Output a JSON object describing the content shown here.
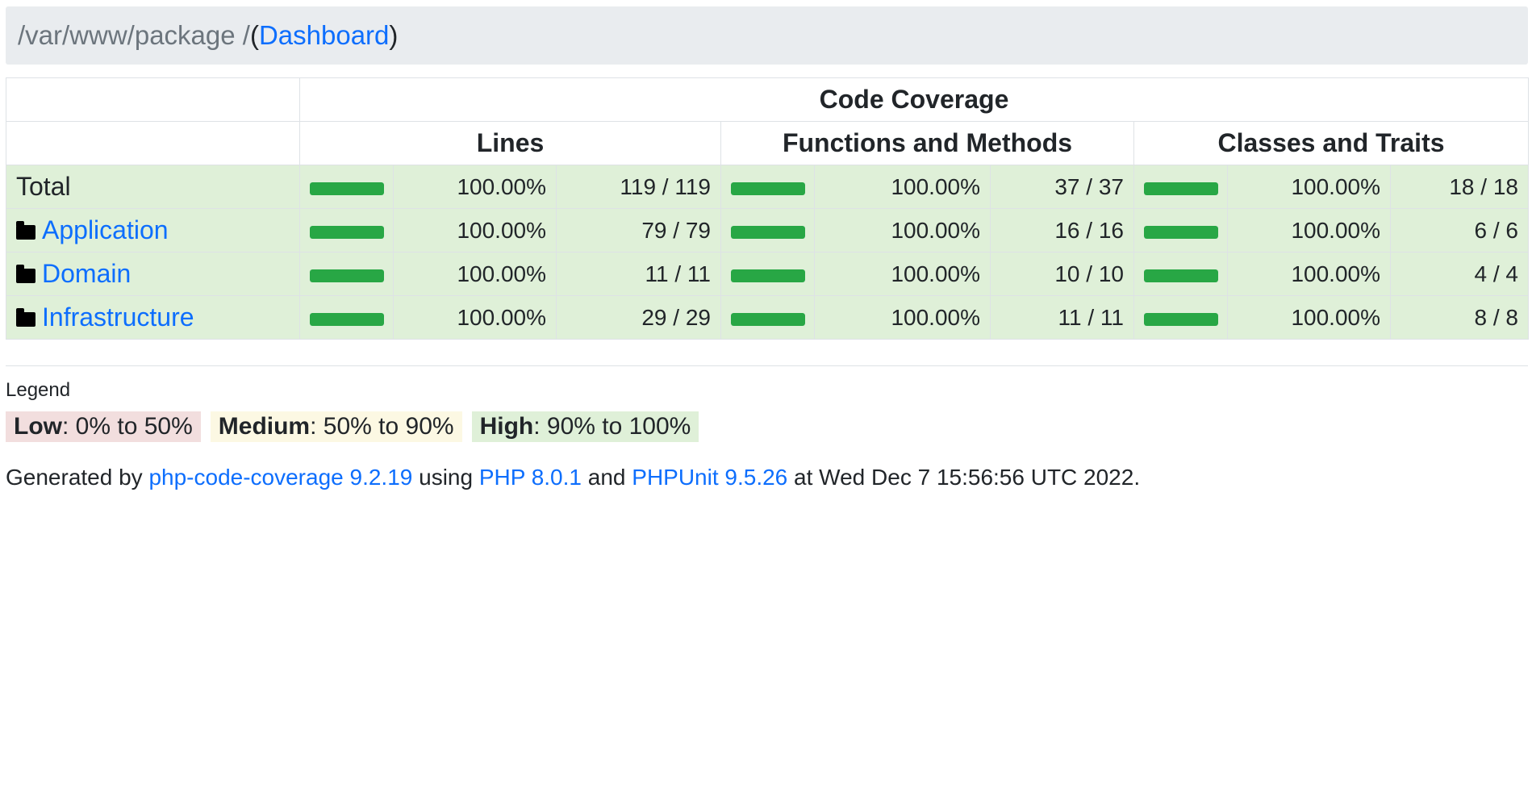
{
  "breadcrumb": {
    "path": "/var/www/package / ",
    "open_paren": "(",
    "dashboard_link": "Dashboard",
    "close_paren": ")"
  },
  "table": {
    "header_group": "Code Coverage",
    "columns": [
      "Lines",
      "Functions and Methods",
      "Classes and Traits"
    ],
    "rows": [
      {
        "name": "Total",
        "is_link": false,
        "lines": {
          "percent": "100.00%",
          "ratio": "119 / 119",
          "fill": 1.0
        },
        "functions": {
          "percent": "100.00%",
          "ratio": "37 / 37",
          "fill": 1.0
        },
        "classes": {
          "percent": "100.00%",
          "ratio": "18 / 18",
          "fill": 1.0
        }
      },
      {
        "name": "Application",
        "is_link": true,
        "icon": "folder-icon",
        "lines": {
          "percent": "100.00%",
          "ratio": "79 / 79",
          "fill": 1.0
        },
        "functions": {
          "percent": "100.00%",
          "ratio": "16 / 16",
          "fill": 1.0
        },
        "classes": {
          "percent": "100.00%",
          "ratio": "6 / 6",
          "fill": 1.0
        }
      },
      {
        "name": "Domain",
        "is_link": true,
        "icon": "folder-icon",
        "lines": {
          "percent": "100.00%",
          "ratio": "11 / 11",
          "fill": 1.0
        },
        "functions": {
          "percent": "100.00%",
          "ratio": "10 / 10",
          "fill": 1.0
        },
        "classes": {
          "percent": "100.00%",
          "ratio": "4 / 4",
          "fill": 1.0
        }
      },
      {
        "name": "Infrastructure",
        "is_link": true,
        "icon": "folder-icon",
        "lines": {
          "percent": "100.00%",
          "ratio": "29 / 29",
          "fill": 1.0
        },
        "functions": {
          "percent": "100.00%",
          "ratio": "11 / 11",
          "fill": 1.0
        },
        "classes": {
          "percent": "100.00%",
          "ratio": "8 / 8",
          "fill": 1.0
        }
      }
    ]
  },
  "legend": {
    "title": "Legend",
    "low_label": "Low",
    "low_range": ": 0% to 50%",
    "medium_label": "Medium",
    "medium_range": ": 50% to 90%",
    "high_label": "High",
    "high_range": ": 90% to 100%"
  },
  "footer": {
    "prefix": "Generated by ",
    "tool_link": "php-code-coverage 9.2.19",
    "using": " using ",
    "php_link": "PHP 8.0.1",
    "and": " and ",
    "phpunit_link": "PHPUnit 9.5.26",
    "suffix": " at Wed Dec 7 15:56:56 UTC 2022."
  },
  "colors": {
    "bar_success": "#28a745",
    "row_high": "#dff0d8",
    "legend_low": "#f2dede",
    "legend_medium": "#fcf8e3",
    "link": "#0d6efd"
  }
}
